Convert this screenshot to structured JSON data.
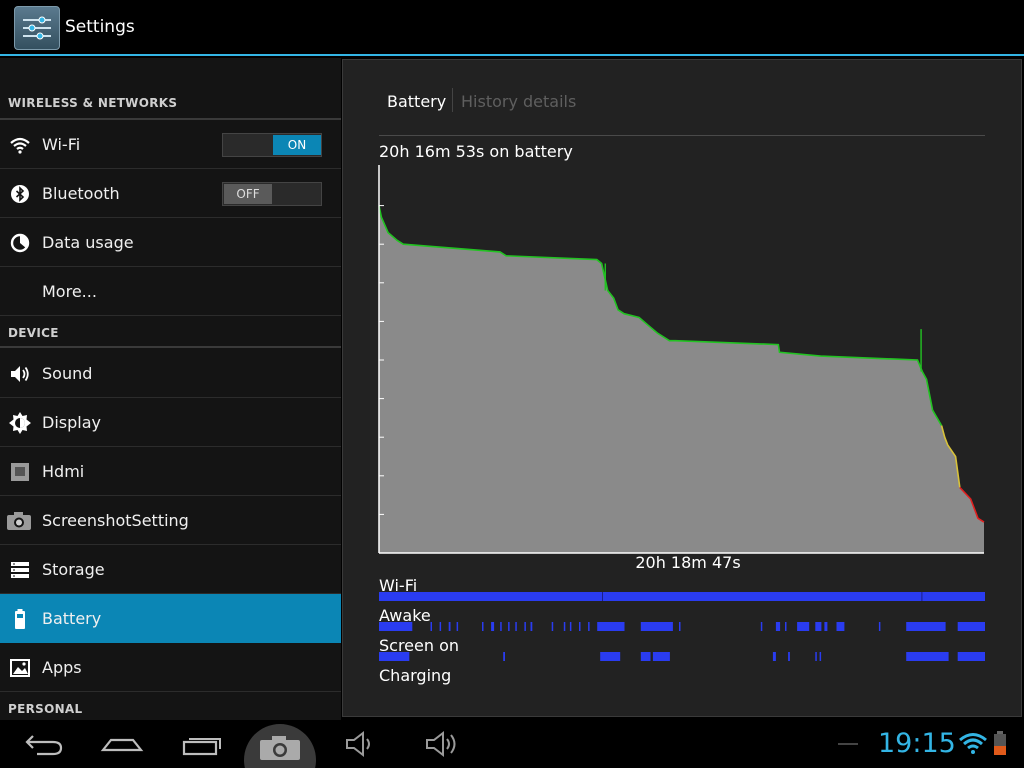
{
  "app": {
    "title": "Settings",
    "icon": "settings-sliders-icon"
  },
  "sections": {
    "wireless": "WIRELESS & NETWORKS",
    "device": "DEVICE",
    "personal": "PERSONAL"
  },
  "items": [
    {
      "label": "Wi-Fi",
      "icon": "wifi-icon",
      "toggle": "ON"
    },
    {
      "label": "Bluetooth",
      "icon": "bluetooth-icon",
      "toggle": "OFF"
    },
    {
      "label": "Data usage",
      "icon": "data-usage-icon"
    },
    {
      "label": "More...",
      "icon": ""
    },
    {
      "label": "Sound",
      "icon": "speaker-icon"
    },
    {
      "label": "Display",
      "icon": "brightness-icon"
    },
    {
      "label": "Hdmi",
      "icon": "hdmi-icon"
    },
    {
      "label": "ScreenshotSetting",
      "icon": "camera-icon"
    },
    {
      "label": "Storage",
      "icon": "storage-icon"
    },
    {
      "label": "Battery",
      "icon": "battery-icon",
      "active": true
    },
    {
      "label": "Apps",
      "icon": "apps-icon"
    }
  ],
  "panel": {
    "tab_battery": "Battery",
    "tab_history": "History details",
    "on_battery": "20h 16m 53s on battery",
    "duration": "20h 18m 47s",
    "rows": [
      "Wi-Fi",
      "Awake",
      "Screen on",
      "Charging"
    ]
  },
  "chart_data": {
    "type": "area",
    "title": "",
    "xlabel": "20h 18m 47s",
    "ylabel": "",
    "x_unit": "fraction of total time",
    "y_unit": "battery percent",
    "ylim": [
      0,
      100
    ],
    "points": [
      [
        0.0,
        90
      ],
      [
        0.004,
        87
      ],
      [
        0.015,
        83
      ],
      [
        0.03,
        81
      ],
      [
        0.04,
        80
      ],
      [
        0.2,
        78
      ],
      [
        0.21,
        77
      ],
      [
        0.36,
        76
      ],
      [
        0.368,
        75
      ],
      [
        0.378,
        68
      ],
      [
        0.388,
        66
      ],
      [
        0.395,
        63
      ],
      [
        0.405,
        62
      ],
      [
        0.43,
        61
      ],
      [
        0.445,
        59
      ],
      [
        0.46,
        57
      ],
      [
        0.48,
        55
      ],
      [
        0.49,
        55
      ],
      [
        0.66,
        54
      ],
      [
        0.662,
        52
      ],
      [
        0.73,
        51
      ],
      [
        0.89,
        50
      ],
      [
        0.898,
        47
      ],
      [
        0.905,
        45
      ],
      [
        0.915,
        37
      ],
      [
        0.93,
        33
      ],
      [
        0.935,
        30
      ],
      [
        0.94,
        28
      ],
      [
        0.953,
        25
      ],
      [
        0.96,
        17
      ],
      [
        0.978,
        14
      ],
      [
        0.99,
        9
      ],
      [
        1.0,
        8
      ]
    ],
    "spikes": [
      {
        "x": 0.374,
        "y": 75
      },
      {
        "x": 0.896,
        "y": 58
      }
    ],
    "segments": [
      {
        "from": 0.0,
        "to": 0.93,
        "color": "#22c322",
        "level": "good"
      },
      {
        "from": 0.93,
        "to": 0.96,
        "color": "#d8c23a",
        "level": "medium"
      },
      {
        "from": 0.96,
        "to": 1.0,
        "color": "#e02020",
        "level": "low"
      }
    ],
    "fill_color": "#8a8a8a",
    "tracks": {
      "Wi-Fi": [
        [
          0.0,
          1.0
        ]
      ],
      "Awake": [
        [
          0.0,
          0.055
        ],
        [
          0.085,
          0.086
        ],
        [
          0.1,
          0.101
        ],
        [
          0.115,
          0.118
        ],
        [
          0.128,
          0.129
        ],
        [
          0.17,
          0.171
        ],
        [
          0.185,
          0.19
        ],
        [
          0.2,
          0.201
        ],
        [
          0.213,
          0.214
        ],
        [
          0.225,
          0.226
        ],
        [
          0.24,
          0.241
        ],
        [
          0.25,
          0.253
        ],
        [
          0.285,
          0.286
        ],
        [
          0.305,
          0.306
        ],
        [
          0.315,
          0.317
        ],
        [
          0.33,
          0.332
        ],
        [
          0.345,
          0.347
        ],
        [
          0.36,
          0.405
        ],
        [
          0.432,
          0.485
        ],
        [
          0.495,
          0.496
        ],
        [
          0.63,
          0.632
        ],
        [
          0.655,
          0.662
        ],
        [
          0.67,
          0.672
        ],
        [
          0.69,
          0.71
        ],
        [
          0.72,
          0.73
        ],
        [
          0.735,
          0.74
        ],
        [
          0.755,
          0.768
        ],
        [
          0.825,
          0.827
        ],
        [
          0.87,
          0.935
        ],
        [
          0.955,
          1.0
        ]
      ],
      "Screen on": [
        [
          0.0,
          0.05
        ],
        [
          0.205,
          0.208
        ],
        [
          0.365,
          0.398
        ],
        [
          0.432,
          0.448
        ],
        [
          0.452,
          0.48
        ],
        [
          0.65,
          0.655
        ],
        [
          0.675,
          0.678
        ],
        [
          0.72,
          0.722
        ],
        [
          0.727,
          0.729
        ],
        [
          0.87,
          0.94
        ],
        [
          0.955,
          1.0
        ]
      ],
      "Charging": []
    },
    "track_color": "#2a3cf0"
  },
  "navbar": {
    "time": "19:15",
    "buttons": [
      "back-icon",
      "home-icon",
      "recent-apps-icon",
      "screenshot-camera-icon",
      "volume-down-icon",
      "volume-up-icon"
    ]
  },
  "colors": {
    "accent": "#33b5e5",
    "selected": "#0b86b5",
    "battery_low": "#e05a1a"
  }
}
